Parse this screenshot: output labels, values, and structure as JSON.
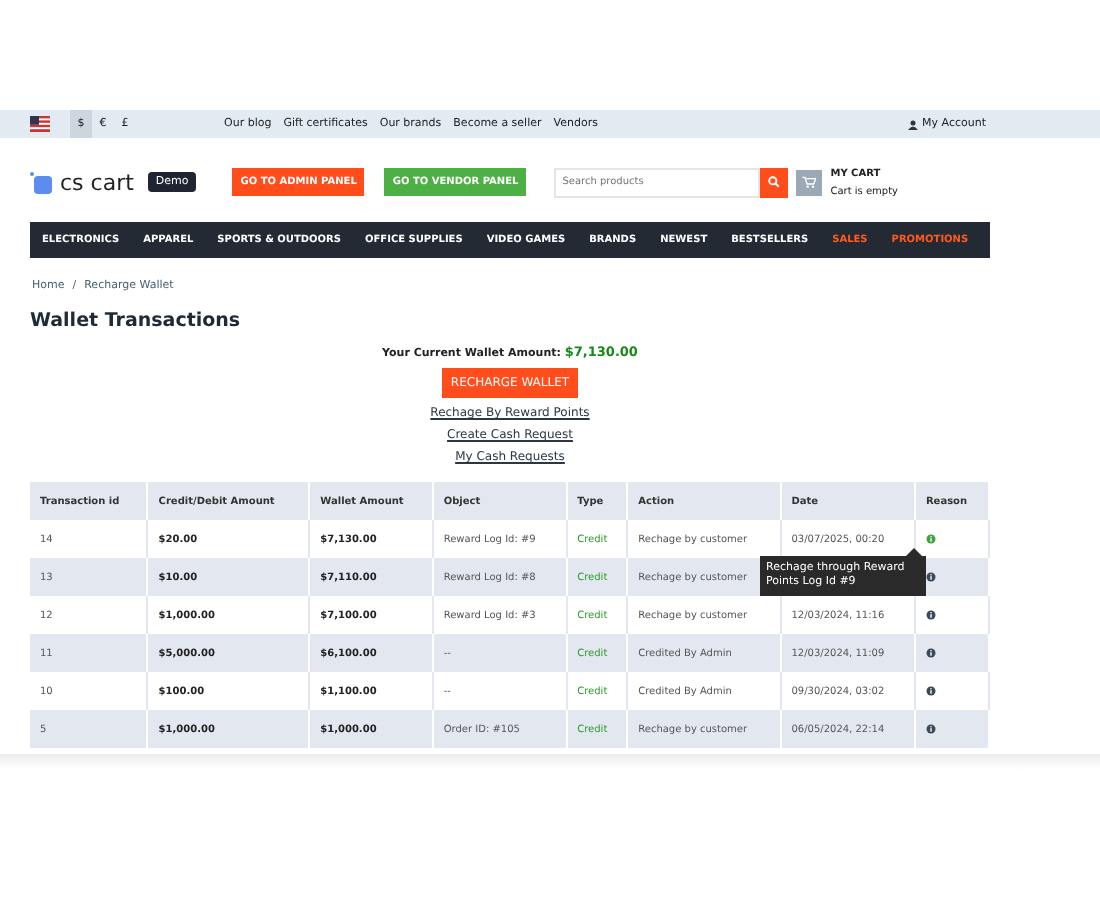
{
  "top_bar": {
    "currencies": [
      {
        "label": "$",
        "selected": true
      },
      {
        "label": "€",
        "selected": false
      },
      {
        "label": "£",
        "selected": false
      }
    ],
    "links": [
      "Our blog",
      "Gift certificates",
      "Our brands",
      "Become a seller",
      "Vendors"
    ],
    "account": "My Account"
  },
  "header": {
    "logo": "cs cart",
    "badge": "Demo",
    "admin_button": "GO TO ADMIN PANEL",
    "vendor_button": "GO TO VENDOR PANEL",
    "search": {
      "placeholder": "Search products"
    },
    "cart": {
      "title": "MY CART",
      "status": "Cart is empty"
    }
  },
  "nav": [
    {
      "label": "ELECTRONICS",
      "promo": false
    },
    {
      "label": "APPAREL",
      "promo": false
    },
    {
      "label": "SPORTS & OUTDOORS",
      "promo": false
    },
    {
      "label": "OFFICE SUPPLIES",
      "promo": false
    },
    {
      "label": "VIDEO GAMES",
      "promo": false
    },
    {
      "label": "BRANDS",
      "promo": false
    },
    {
      "label": "NEWEST",
      "promo": false
    },
    {
      "label": "BESTSELLERS",
      "promo": false
    },
    {
      "label": "SALES",
      "promo": true
    },
    {
      "label": "PROMOTIONS",
      "promo": true
    }
  ],
  "breadcrumbs": {
    "items": [
      "Home",
      "Recharge Wallet"
    ],
    "separator": "/"
  },
  "title": "Wallet Transactions",
  "wallet": {
    "label": "Your Current Wallet Amount:",
    "amount": "$7,130.00"
  },
  "recharge_button": "RECHARGE WALLET",
  "links": [
    "Rechage By Reward Points",
    "Create Cash Request",
    "My Cash Requests"
  ],
  "table": {
    "columns": [
      "Transaction id",
      "Credit/Debit Amount",
      "Wallet Amount",
      "Object",
      "Type",
      "Action",
      "Date",
      "Reason"
    ],
    "rows": [
      {
        "id": "14",
        "amount": "$20.00",
        "wallet": "$7,130.00",
        "object": "Reward Log Id: #9",
        "type": "Credit",
        "action": "Rechage by customer",
        "date": "03/07/2025, 00:20",
        "reason_active": true,
        "tooltip": "Rechage through Reward Points Log Id #9"
      },
      {
        "id": "13",
        "amount": "$10.00",
        "wallet": "$7,110.00",
        "object": "Reward Log Id: #8",
        "type": "Credit",
        "action": "Rechage by customer",
        "reason_active": false
      },
      {
        "id": "12",
        "amount": "$1,000.00",
        "wallet": "$7,100.00",
        "object": "Reward Log Id: #3",
        "type": "Credit",
        "action": "Rechage by customer",
        "date": "12/03/2024, 11:16",
        "reason_active": false
      },
      {
        "id": "11",
        "amount": "$5,000.00",
        "wallet": "$6,100.00",
        "object": "--",
        "type": "Credit",
        "action": "Credited By Admin",
        "date": "12/03/2024, 11:09",
        "reason_active": false
      },
      {
        "id": "10",
        "amount": "$100.00",
        "wallet": "$1,100.00",
        "object": "--",
        "type": "Credit",
        "action": "Credited By Admin",
        "date": "09/30/2024, 03:02",
        "reason_active": false
      },
      {
        "id": "5",
        "amount": "$1,000.00",
        "wallet": "$1,000.00",
        "object": "Order ID: #105",
        "type": "Credit",
        "action": "Rechage by customer",
        "date": "06/05/2024, 22:14",
        "reason_active": false
      }
    ]
  }
}
